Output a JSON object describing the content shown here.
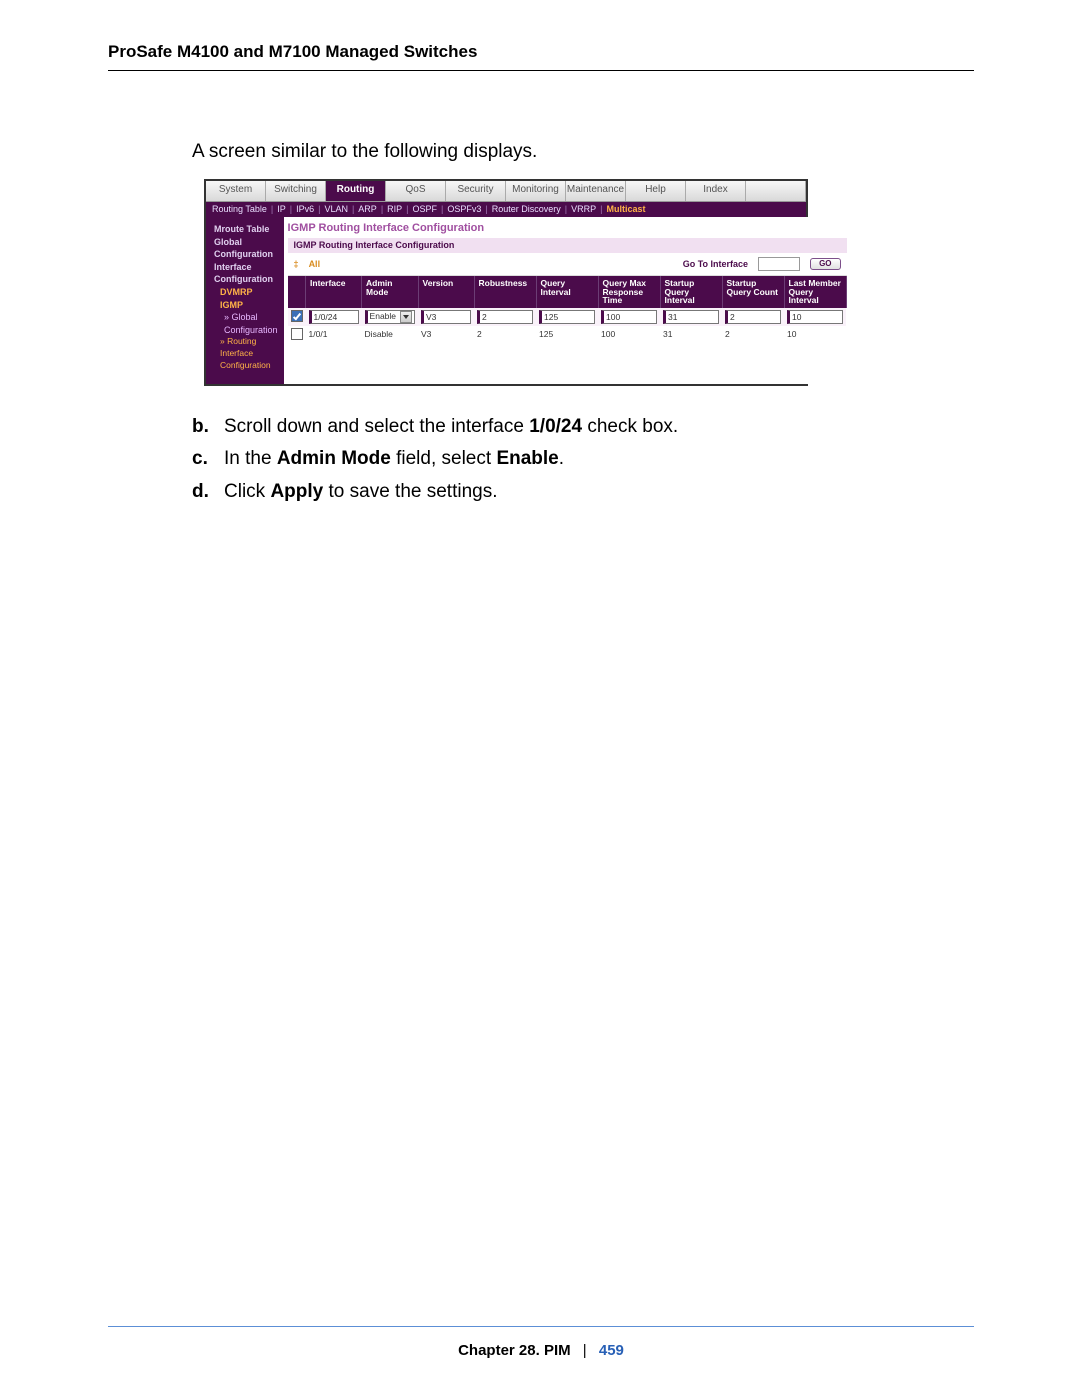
{
  "header": {
    "title": "ProSafe M4100 and M7100 Managed Switches"
  },
  "intro": "A screen similar to the following displays.",
  "screenshot": {
    "tabs": [
      "System",
      "Switching",
      "Routing",
      "QoS",
      "Security",
      "Monitoring",
      "Maintenance",
      "Help",
      "Index"
    ],
    "active_tab": "Routing",
    "subnav": [
      "Routing Table",
      "IP",
      "IPv6",
      "VLAN",
      "ARP",
      "RIP",
      "OSPF",
      "OSPFv3",
      "Router Discovery",
      "VRRP",
      "Multicast"
    ],
    "subnav_active": "Multicast",
    "sidebar": {
      "items": [
        {
          "label": "Mroute Table",
          "cls": "bold"
        },
        {
          "label": "Global",
          "cls": "bold"
        },
        {
          "label": "Configuration",
          "cls": "bold"
        },
        {
          "label": "Interface",
          "cls": "bold"
        },
        {
          "label": "Configuration",
          "cls": "bold"
        },
        {
          "label": "DVMRP",
          "cls": "lvl2"
        },
        {
          "label": "IGMP",
          "cls": "lvl2"
        },
        {
          "label": "» Global",
          "cls": "sub"
        },
        {
          "label": "Configuration",
          "cls": "sub"
        },
        {
          "label": "» Routing Interface",
          "cls": "sub-active"
        },
        {
          "label": "Configuration",
          "cls": "sub-active"
        }
      ]
    },
    "section_title": "IGMP Routing Interface Configuration",
    "subsection_title": "IGMP Routing Interface Configuration",
    "filter": {
      "all": "All",
      "label": "Go To Interface",
      "button": "GO"
    },
    "columns": [
      "",
      "Interface",
      "Admin Mode",
      "Version",
      "Robustness",
      "Query Interval",
      "Query Max Response Time",
      "Startup Query Interval",
      "Startup Query Count",
      "Last Member Query Interval"
    ],
    "rows": [
      {
        "checked": true,
        "cells": [
          "1/0/24",
          "Enable",
          "V3",
          "2",
          "125",
          "100",
          "31",
          "2",
          "10"
        ],
        "editable": true
      },
      {
        "checked": false,
        "cells": [
          "1/0/1",
          "Disable",
          "V3",
          "2",
          "125",
          "100",
          "31",
          "2",
          "10"
        ],
        "editable": false
      }
    ]
  },
  "steps": {
    "b": {
      "pre": "Scroll down and select the interface ",
      "bold": "1/0/24",
      "post": " check box."
    },
    "c": {
      "pre": "In the ",
      "b1": "Admin Mode",
      "mid": " field, select ",
      "b2": "Enable",
      "post": "."
    },
    "d": {
      "pre": "Click ",
      "b1": "Apply",
      "post": " to save the settings."
    }
  },
  "footer": {
    "chapter": "Chapter 28.  PIM",
    "page": "459"
  }
}
